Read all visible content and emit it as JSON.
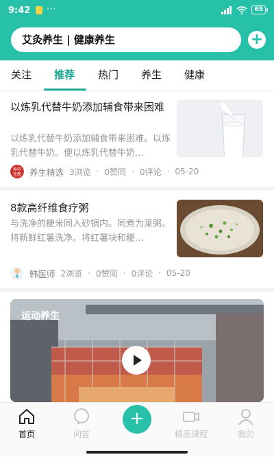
{
  "status_bar": {
    "time": "9:42",
    "battery": "65"
  },
  "search": {
    "text": "艾灸养生 | 健康养生"
  },
  "tabs": [
    {
      "label": "关注"
    },
    {
      "label": "推荐",
      "active": true
    },
    {
      "label": "热门"
    },
    {
      "label": "养生"
    },
    {
      "label": "健康"
    }
  ],
  "feed": [
    {
      "title": "以炼乳代替牛奶添加辅食带来困难",
      "summary": "以炼乳代替牛奶添加辅食带来困难。以炼乳代替牛奶。便以炼乳代替牛奶…",
      "author": "养生精选",
      "avatar_text": "养中生医",
      "views": "3浏览",
      "likes": "0赞同",
      "comments": "0评论",
      "date": "05-20",
      "image": "milk-image"
    },
    {
      "title": "8款高纤维食疗粥",
      "summary": "与洗净的粳米同入砂锅内。同煮为莱粥。将新鲜红薯洗净。将红薯块和粳…",
      "author": "韩医师",
      "views": "2浏览",
      "likes": "0赞同",
      "comments": "0评论",
      "date": "05-20",
      "image": "porridge-image"
    }
  ],
  "video_card": {
    "label": "运动养生"
  },
  "bottom_nav": [
    {
      "label": "首页",
      "icon": "home-icon",
      "active": true
    },
    {
      "label": "问答",
      "icon": "chat-icon"
    },
    {
      "label": "",
      "icon": "plus-icon"
    },
    {
      "label": "精品课程",
      "icon": "video-camera-icon"
    },
    {
      "label": "我的",
      "icon": "user-icon"
    }
  ],
  "colors": {
    "accent": "#27c0a8",
    "tab_active": "#1aa894"
  }
}
